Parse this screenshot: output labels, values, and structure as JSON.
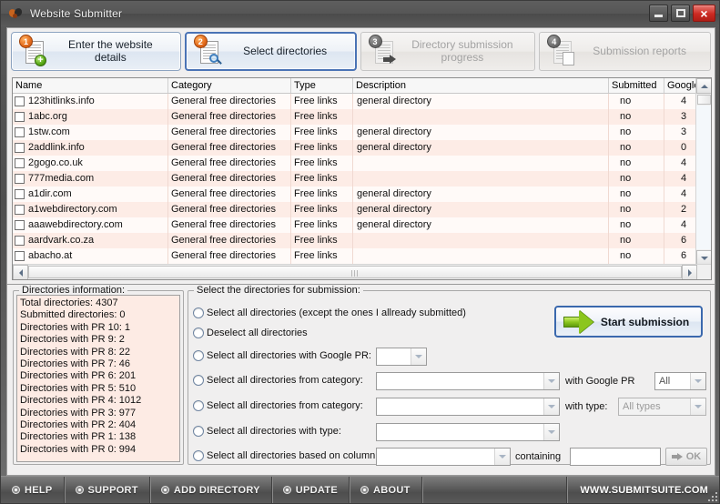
{
  "window": {
    "title": "Website Submitter",
    "icon": "app-logo-icon",
    "minimize_label": "",
    "maximize_label": "",
    "close_label": "×"
  },
  "toolbar": {
    "steps": [
      {
        "number": "1",
        "label": "Enter the website details",
        "state": "enabled",
        "icon": "document-add-icon"
      },
      {
        "number": "2",
        "label": "Select directories",
        "state": "selected",
        "icon": "document-search-icon"
      },
      {
        "number": "3",
        "label": "Directory submission progress",
        "state": "disabled",
        "icon": "document-arrow-icon"
      },
      {
        "number": "4",
        "label": "Submission reports",
        "state": "disabled",
        "icon": "document-report-icon"
      }
    ]
  },
  "grid": {
    "columns": [
      "Name",
      "Category",
      "Type",
      "Description",
      "Submitted",
      "Google P"
    ],
    "rows": [
      {
        "name": "123hitlinks.info",
        "category": "General free directories",
        "type": "Free links",
        "description": "general directory",
        "submitted": "no",
        "pr": "4"
      },
      {
        "name": "1abc.org",
        "category": "General free directories",
        "type": "Free links",
        "description": "",
        "submitted": "no",
        "pr": "3"
      },
      {
        "name": "1stw.com",
        "category": "General free directories",
        "type": "Free links",
        "description": "general directory",
        "submitted": "no",
        "pr": "3"
      },
      {
        "name": "2addlink.info",
        "category": "General free directories",
        "type": "Free links",
        "description": "general directory",
        "submitted": "no",
        "pr": "0"
      },
      {
        "name": "2gogo.co.uk",
        "category": "General free directories",
        "type": "Free links",
        "description": "",
        "submitted": "no",
        "pr": "4"
      },
      {
        "name": "777media.com",
        "category": "General free directories",
        "type": "Free links",
        "description": "",
        "submitted": "no",
        "pr": "4"
      },
      {
        "name": "a1dir.com",
        "category": "General free directories",
        "type": "Free links",
        "description": "general directory",
        "submitted": "no",
        "pr": "4"
      },
      {
        "name": "a1webdirectory.com",
        "category": "General free directories",
        "type": "Free links",
        "description": "general directory",
        "submitted": "no",
        "pr": "2"
      },
      {
        "name": "aaawebdirectory.com",
        "category": "General free directories",
        "type": "Free links",
        "description": "general directory",
        "submitted": "no",
        "pr": "4"
      },
      {
        "name": "aardvark.co.za",
        "category": "General free directories",
        "type": "Free links",
        "description": "",
        "submitted": "no",
        "pr": "6"
      },
      {
        "name": "abacho.at",
        "category": "General free directories",
        "type": "Free links",
        "description": "",
        "submitted": "no",
        "pr": "6"
      }
    ]
  },
  "info_panel": {
    "title": "Directories information:",
    "lines": [
      "Total directories:     4307",
      "Submitted directories: 0",
      "Directories with PR 10: 1",
      "Directories with PR 9: 2",
      "Directories with PR 8: 22",
      "Directories with PR 7: 46",
      "Directories with PR 6: 201",
      "Directories with PR 5: 510",
      "Directories with PR 4: 1012",
      "Directories with PR 3: 977",
      "Directories with PR 2: 404",
      "Directories with PR 1: 138",
      "Directories with PR 0: 994"
    ]
  },
  "select_panel": {
    "title": "Select the directories for submission:",
    "options": [
      {
        "label": "Select all directories (except the ones I allready submitted)"
      },
      {
        "label": "Deselect all directories"
      },
      {
        "label": "Select all directories with Google PR:"
      },
      {
        "label": "Select all directories from category:"
      },
      {
        "label": "Select all directories from category:"
      },
      {
        "label": "Select all directories with type:"
      },
      {
        "label": "Select all directories based on column:"
      }
    ],
    "pr_combo_value": "",
    "category_combo_1_value": "",
    "category_combo_2_value": "",
    "type_combo_value": "",
    "column_combo_value": "",
    "with_google_pr_label": "with Google PR",
    "google_pr_filter_value": "All",
    "with_type_label": "with type:",
    "type_filter_value": "All types",
    "containing_label": "containing",
    "containing_value": "",
    "ok_label": "OK",
    "start_button_label": "Start submission"
  },
  "statusbar": {
    "items": [
      "HELP",
      "SUPPORT",
      "ADD DIRECTORY",
      "UPDATE",
      "ABOUT"
    ],
    "url": "WWW.SUBMITSUITE.COM"
  }
}
